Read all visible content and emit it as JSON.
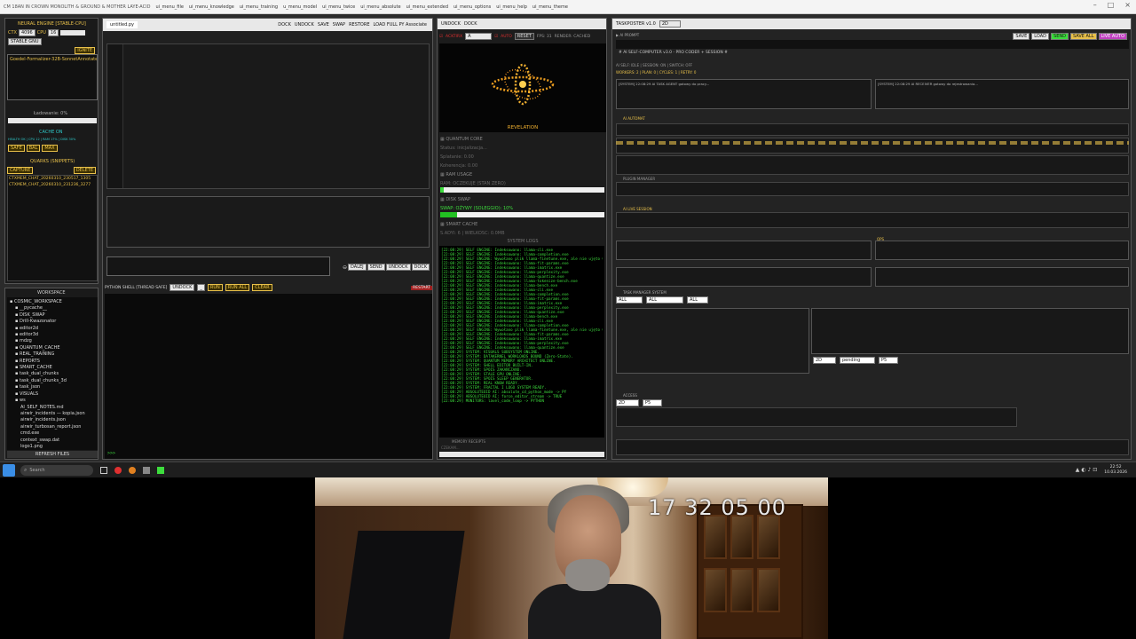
{
  "topbar": {
    "title": "CM 18AN IN CROWN MONOLITH & GROUND & MOTHER LAYE-ACID",
    "menus": [
      "ui_menu_file",
      "ui_menu_knowledge",
      "ui_menu_training",
      "u_menu_model",
      "ui_menu_twice",
      "ui_menu_absolute",
      "ui_menu_extended",
      "ui_menu_options",
      "ui_menu_help",
      "ui_menu_theme"
    ]
  },
  "left_panel": {
    "engine_title": "NEURAL ENGINE [STABLE-CPU]",
    "ctx_label": "CTX",
    "ctx_value": "4096",
    "cpu_label": "CPU",
    "cpu_value": "16",
    "stable_badge": "STABLE GNU",
    "ignite": "IGNITE",
    "model": "Goedel-Formalizer-32B-SonnetAnnotate",
    "loading": "Ładowanie: 0%",
    "cache_on": "CACHE ON",
    "cache_stats": "HEALTH OK | CPU 12 | RAM 17% | DISK 30%",
    "btn_safe": "SAFE",
    "btn_bal": "BAL",
    "btn_max": "MAX",
    "quarks_title": "QUARKS (SNIPPETS)",
    "capture": "CAPTURE",
    "delete": "DELETE",
    "quarks": [
      "CTXMEM_CHAT_20260310_230517_1305",
      "CTXMEM_CHAT_20260310_231236_3277"
    ]
  },
  "workspace": {
    "title": "WORKSPACE",
    "items": [
      "COSMIC_WORKSPACE",
      "__pycache__",
      "DISK_SWAP",
      "Drill-Kwazonator",
      "editor2d",
      "editor3d",
      "mdzg",
      "QUANTUM_CACHE",
      "REAL_TRAINING",
      "REPORTS",
      "SMART_CACHE",
      "task_dual_chunks",
      "task_dual_chunks_3d",
      "task_json",
      "VISUALS",
      "ws",
      "AI_SELF_NOTES.md",
      "airwir_incidents — kopia.json",
      "airwir_incidents.json",
      "airwir_turbosan_report.json",
      "cmd.exe",
      "context_swap.dat",
      "logo1.png"
    ],
    "refresh": "REFRESH FILES"
  },
  "editor": {
    "tab": "untitled.py",
    "actions": [
      "DOCK",
      "UNDOCK",
      "SAVE",
      "SWAP",
      "RESTORE",
      "LOAD FULL PY Associate"
    ],
    "dalej": "DALEJ",
    "send": "SEND",
    "undock": "UNDOCK",
    "dock": "DOCK",
    "shell_title": "PYTHON SHELL [THREAD SAFE]",
    "shell_btns": [
      "UNDOCK",
      "_",
      "RUN",
      "RUN ALL",
      "CLEAR"
    ],
    "restart": "RESTART",
    "prompt": ">>>"
  },
  "monitor": {
    "tab_undock": "UNDOCK",
    "tab_dock": "DOCK",
    "activate": "ACKTIRX",
    "combo": "A",
    "auto": "AUTO",
    "reset": "RESET",
    "fps": "FPS: 31",
    "render": "RENDER: CACHED",
    "revelation": "REVELATION",
    "quantum_core": "QUANTUM CORE",
    "status": "Status: inicjalizacja...",
    "splatanie": "Splatanie: 0.00",
    "koherencja": "Koherencja: 0.00",
    "ram_usage": "RAM USAGE",
    "ram_text": "RAM: OCZEKUJE (STAN ZERO)",
    "ram_pct": 0.02,
    "disk_swap": "DISK SWAP",
    "swap_text": "SWAP: OŻYWY (SOLEGGIO): 10%",
    "swap_pct": 0.1,
    "smart_cache": "SMART CACHE",
    "smart_text": "S.ADYI: 6 | WIELKOSC: 0.0MB",
    "logs_title": "SYSTEM LOGS",
    "logs": [
      "[22:08:29] SELF ENGINE: Indeksowano: llama-cli.exe",
      "[22:08:29] SELF ENGINE: Indeksowano: llama-completion.exe",
      "[22:08:29] SELF ENGINE: Wywołano plik llama-finetune.exe, ale nie ujęto w file",
      "[22:08:29] SELF ENGINE: Indeksowano: llama-fit-params.exe",
      "[22:08:29] SELF ENGINE: Indeksowano: llama-imatrix.exe",
      "[22:08:29] SELF ENGINE: Indeksowano: llama-perplexity.exe",
      "[22:08:29] SELF ENGINE: Indeksowano: llama-quantize.exe",
      "[22:08:29] SELF ENGINE: Indeksowano: llama-tokenize-bench.exe",
      "[22:08:29] SELF ENGINE: Indeksowano: llama-bench.exe",
      "[22:08:29] SELF ENGINE: Indeksowano: llama-cli.exe",
      "[22:08:29] SELF ENGINE: Indeksowano: llama-completion.exe",
      "[22:08:29] SELF ENGINE: Indeksowano: llama-fit-params.exe",
      "[22:08:29] SELF ENGINE: Indeksowano: llama-imatrix.exe",
      "[22:08:29] SELF ENGINE: Indeksowano: llama-perplexity.exe",
      "[22:08:29] SELF ENGINE: Indeksowano: llama-quantize.exe",
      "[22:08:29] SELF ENGINE: Indeksowano: llama-bench.exe",
      "[22:08:29] SELF ENGINE: Indeksowano: llama-cli.exe",
      "[22:08:29] SELF ENGINE: Indeksowano: llama-completion.exe",
      "[22:08:29] SELF ENGINE: Wywołano plik llama-finetune.exe, ale nie ujęto w file",
      "[22:08:29] SELF ENGINE: Indeksowano: llama-fit-params.exe",
      "[22:08:29] SELF ENGINE: Indeksowano: llama-imatrix.exe",
      "[22:08:29] SELF ENGINE: Indeksowano: llama-perplexity.exe",
      "[22:08:29] SELF ENGINE: Indeksowano: llama-quantize.exe",
      "[22:08:29] SYSTEM: VISUALS SUBSYSTEM ONLINE.",
      "[22:08:29] SYSTEM: DATAKERNEL WORKLOADS BOUND (Zero-State).",
      "[22:08:29] SYSTEM: QUANTUM MEMORY ARCHITECT ONLINE.",
      "[22:08:29] SYSTEM: SHELL EDITOR BUILT-IN.",
      "[22:08:29] SYSTEM: SPOIS ZAKAŃCZANO.",
      "[22:08:29] SYSTEM: STALE GPU ONLINE.",
      "[22:08:29] SYSTEM: SPOIS SLEEP GENERATOR.",
      "[22:08:29] SYSTEM: REAL KNOW READY.",
      "[22:08:29] SYSTEM: FRACTAL I LOGO SYSTEM READY.",
      "[22:08:29] ABSOLUTEOID AI: absolute_cd_python_mode -> PY",
      "[22:08:29] ABSOLUTEOID AI: force_editor_stream -> TRUE",
      "[22:08:29] MONITORS: lavel_code_loop -> PYTHON"
    ],
    "memory_title": "MEMORY RECEIPTS",
    "memory_sub": "CZEKAM..."
  },
  "right": {
    "title": "TASKPOSTER v1.0",
    "header_btns": [
      "SAVE",
      "LOAD",
      "SEND",
      "SAVE ALL",
      "LIVE AUTO"
    ],
    "subtitle": "# AI SELF-COMPUTER v3.0 - PRO CODER + SESSION #",
    "stats": "AI SELF: IDLE | SESSION: ON | SWITCH: OFF",
    "swarm_line": "WORKERS: 2 | PLAN: 0 | CYCLES: 1 | RETRY: 0",
    "area_left": "[SYSTEM] 22:08:29 AI TASK AGENT gotowy do pracy...",
    "area_right": "[SYSTEM] 22:08:29 AI RECEIVER gotowy do rejestrowania...",
    "section1": "AI AUTOMAT",
    "plugins": "PLUGIN MANAGER",
    "live_session": "AI LIVE SESSION",
    "section_ops": "OPS",
    "filter_all_1": "ALL",
    "filter_all_2": "ALL",
    "filter_all_3": "ALL",
    "pending": "pending",
    "p_value": "P5",
    "dim_value": "2D",
    "task_title": "TASK MANAGER SYSTEM",
    "bottom_label": "ACCESS",
    "bottom_values": [
      "2D",
      "P5"
    ]
  },
  "webcam": {
    "timestamp": "17 32 05 00"
  },
  "taskbar": {
    "search": "Search",
    "time": "22:52",
    "date": "10.03.2026"
  }
}
